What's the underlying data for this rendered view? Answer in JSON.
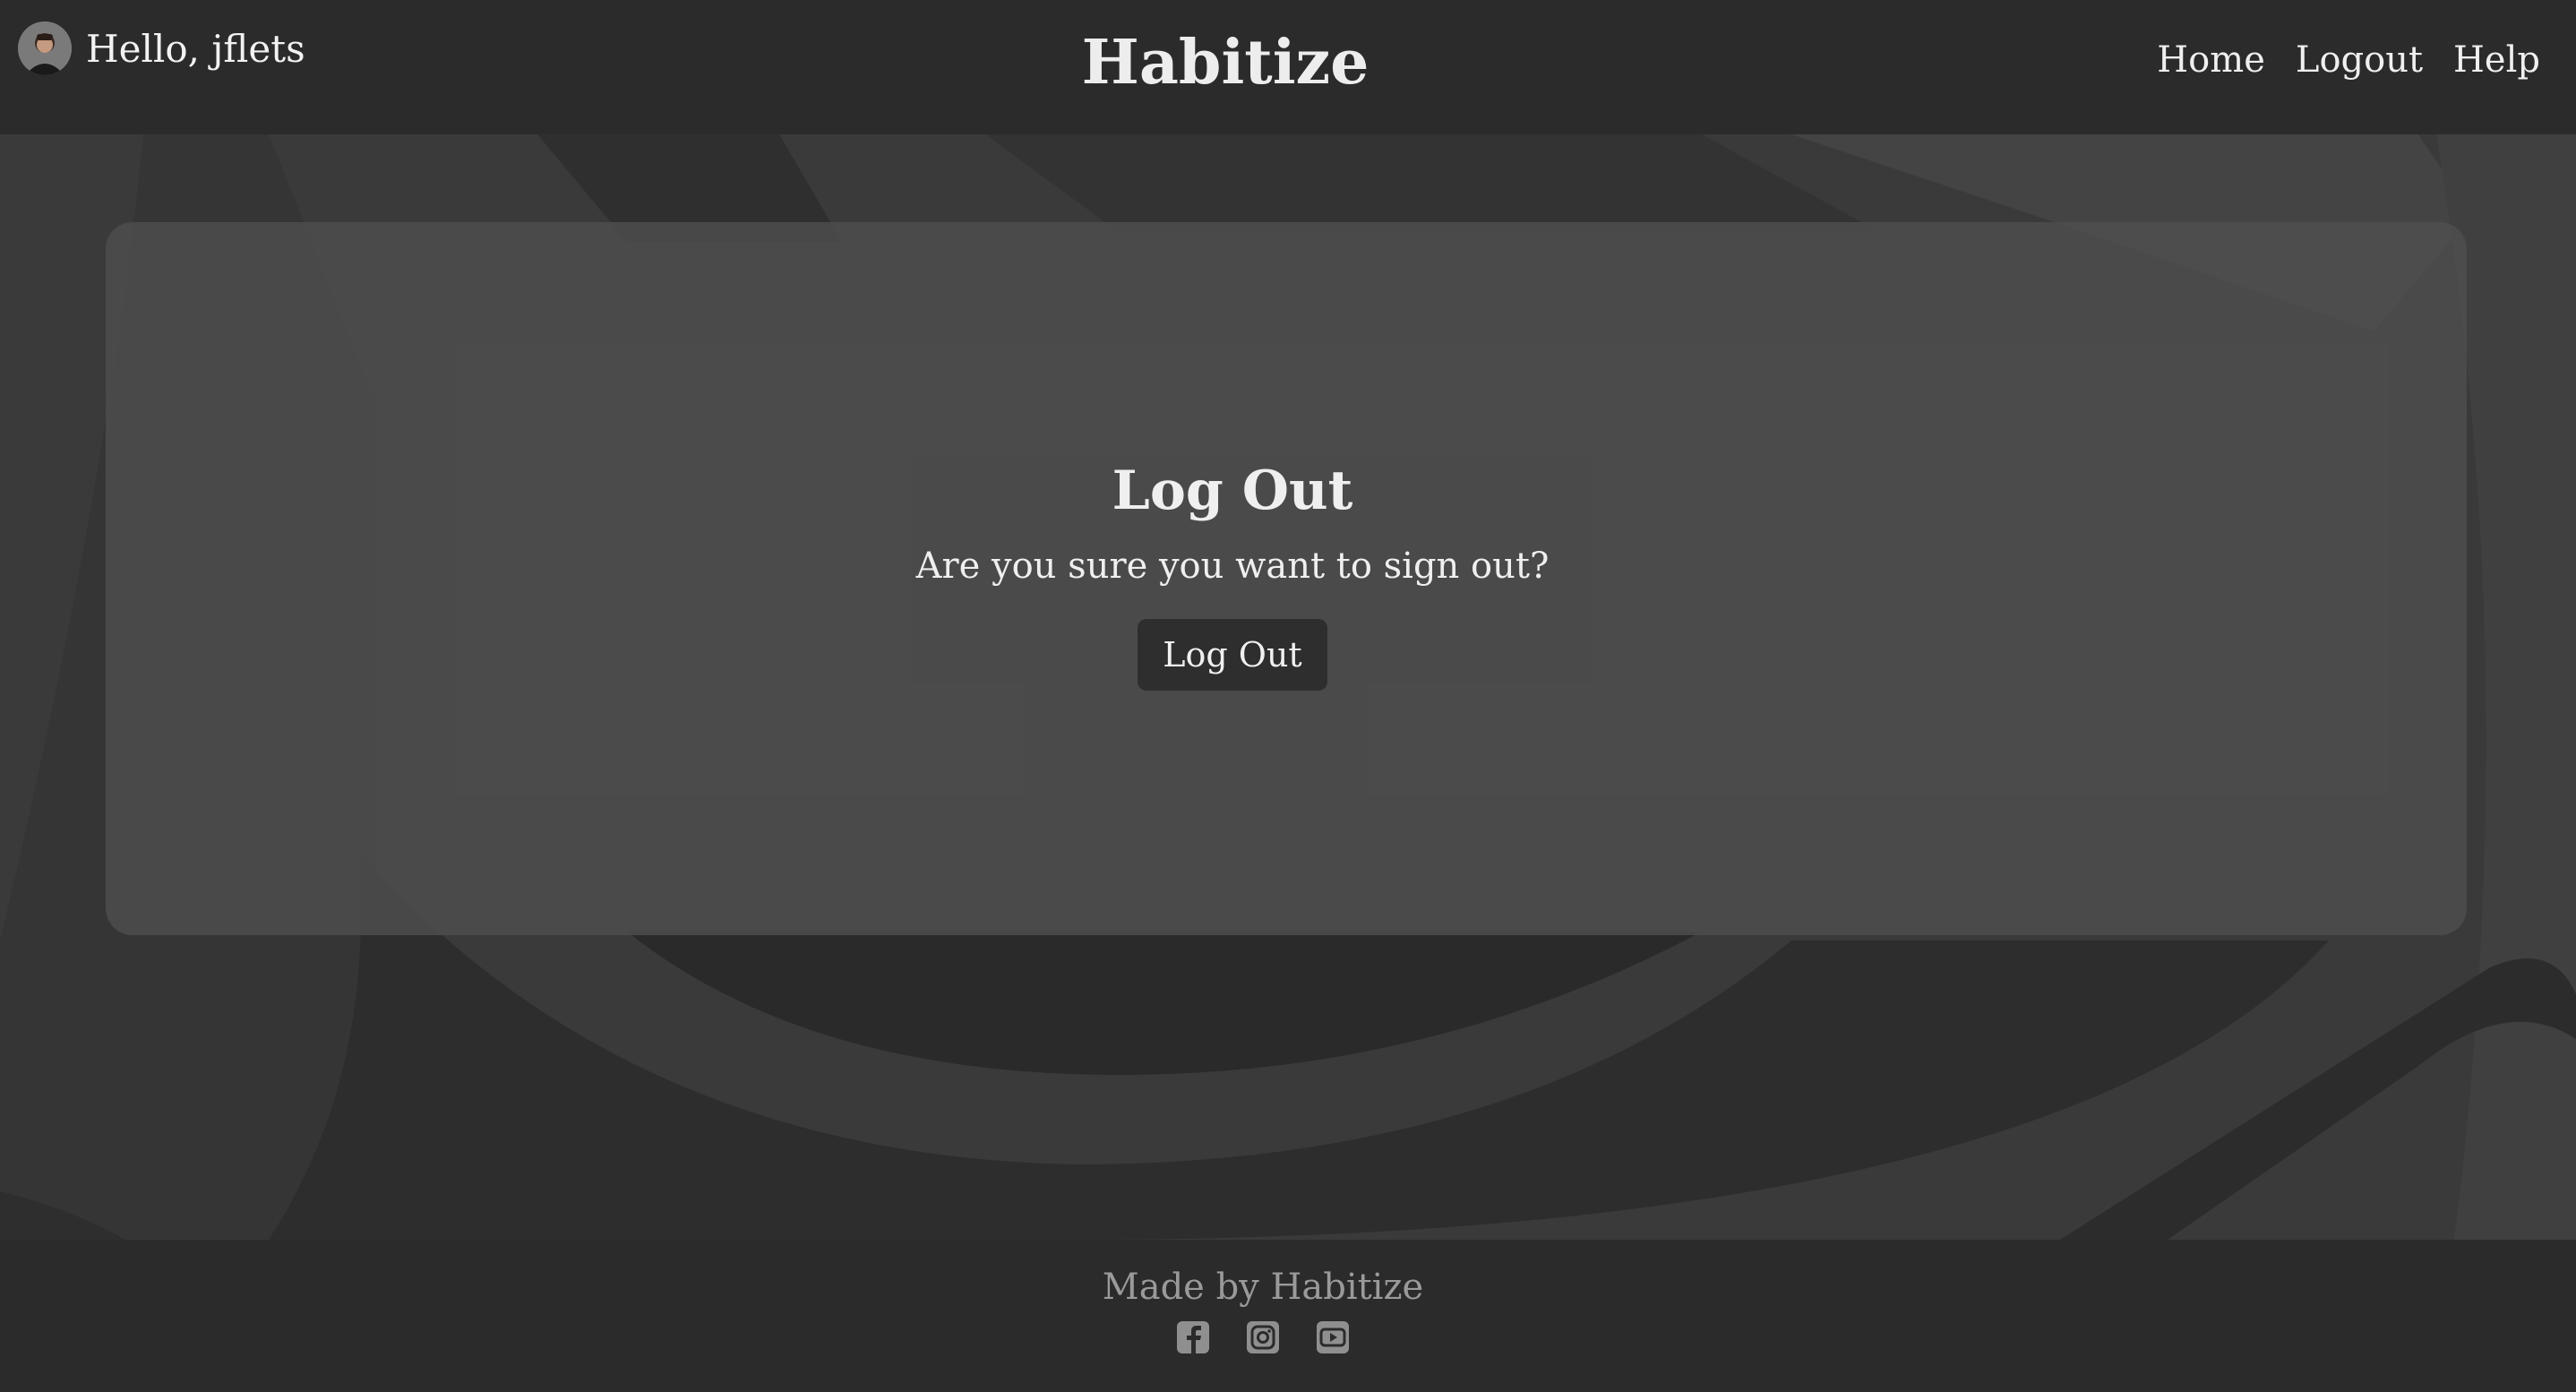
{
  "header": {
    "greeting": "Hello, jflets",
    "brand": "Habitize",
    "nav": {
      "home": "Home",
      "logout": "Logout",
      "help": "Help"
    }
  },
  "card": {
    "title": "Log Out",
    "subtitle": "Are you sure you want to sign out?",
    "button_label": "Log Out"
  },
  "footer": {
    "text": "Made by Habitize",
    "icons": [
      "facebook-icon",
      "instagram-icon",
      "youtube-icon"
    ]
  },
  "colors": {
    "header_bg": "#2b2b2b",
    "page_bg": "#3a3a3a",
    "card_bg": "#505050",
    "button_bg": "#2e2e2e",
    "footer_text": "#9a9a9a"
  }
}
